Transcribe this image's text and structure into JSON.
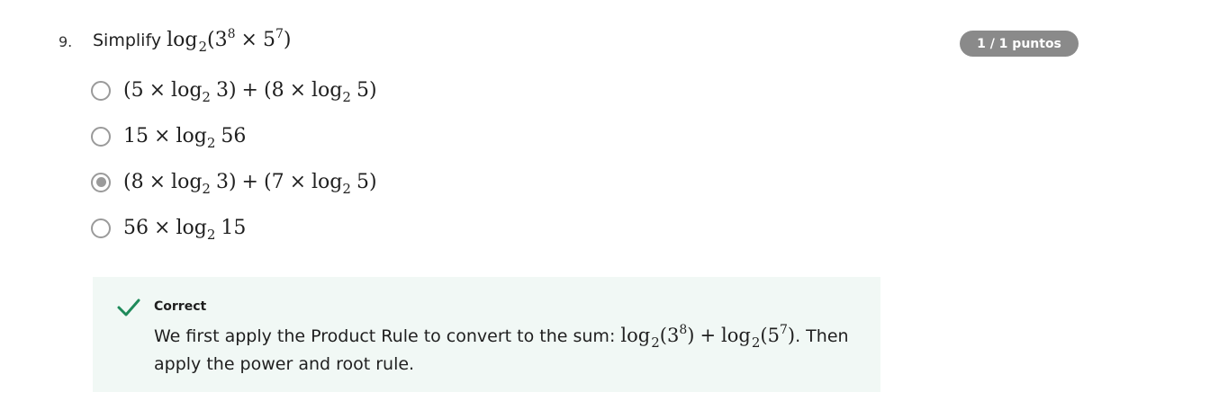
{
  "question": {
    "number": "9.",
    "lead": "Simplify",
    "score_badge": "1 / 1 puntos"
  },
  "options": [
    {
      "selected": false,
      "a": "5",
      "b": "3",
      "c": "8",
      "d": "5"
    },
    {
      "selected": false,
      "coef": "15",
      "arg": "56"
    },
    {
      "selected": true,
      "a": "8",
      "b": "3",
      "c": "7",
      "d": "5"
    },
    {
      "selected": false,
      "coef": "56",
      "arg": "15"
    }
  ],
  "feedback": {
    "title": "Correct",
    "text_before": "We first apply the Product Rule to convert to the sum:",
    "text_after": ". Then apply the power and root rule.",
    "accent_color": "#1e8a5a",
    "background_color": "#f1f8f5"
  },
  "colors": {
    "badge": "#8a8a8a",
    "radio": "#9a9a9a"
  }
}
